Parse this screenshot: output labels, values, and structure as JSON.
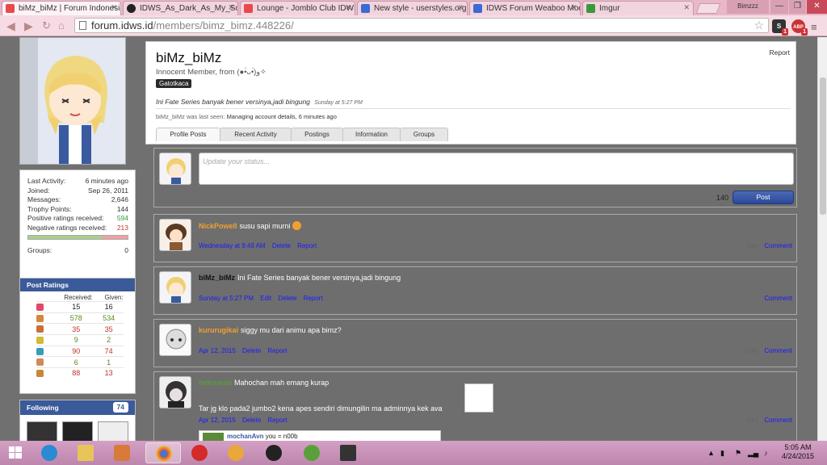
{
  "browser": {
    "tabs": [
      {
        "title": "biMz_biMz | Forum Indonesia",
        "icon": "idws-favicon-icon",
        "color": "#e84a4a",
        "active": false
      },
      {
        "title": "IDWS_As_Dark_As_My_Soul",
        "icon": "github-icon",
        "color": "#222222",
        "active": false
      },
      {
        "title": "Lounge - Jomblo Club IDWS",
        "icon": "idws-favicon-icon",
        "color": "#e84a4a",
        "active": false
      },
      {
        "title": "New style - userstyles.org",
        "icon": "userstyles-icon",
        "color": "#3a6ad4",
        "active": false
      },
      {
        "title": "IDWS Forum Weaboo Mode",
        "icon": "userstyles-icon",
        "color": "#3a6ad4",
        "active": false
      },
      {
        "title": "Imgur",
        "icon": "imgur-icon",
        "color": "#3a9a3a",
        "active": true
      }
    ],
    "user_label": "Bimzzz",
    "url_domain": "forum.idws.id",
    "url_path": "/members/bimz_bimz.448226/",
    "ext_badges": [
      "1",
      "1"
    ],
    "ext_abp": "ABP"
  },
  "sidebar": {
    "stats": [
      {
        "label": "Last Activity:",
        "value": "6 minutes ago",
        "tone": ""
      },
      {
        "label": "Joined:",
        "value": "Sep 26, 2011",
        "tone": ""
      },
      {
        "label": "Messages:",
        "value": "2,646",
        "tone": ""
      },
      {
        "label": "Trophy Points:",
        "value": "144",
        "tone": ""
      },
      {
        "label": "Positive ratings received:",
        "value": "594",
        "tone": "green"
      },
      {
        "label": "Negative ratings received:",
        "value": "213",
        "tone": "red"
      }
    ],
    "rating_positive_fraction": 0.74,
    "groups_label": "Groups:",
    "groups_value": "0",
    "post_ratings_title": "Post Ratings",
    "received_label": "Received:",
    "given_label": "Given:",
    "ratings": [
      {
        "icon": "heart-icon",
        "color": "#e04a6a",
        "received": "15",
        "given": "16",
        "tone": "#222222"
      },
      {
        "icon": "thumbs-up-icon",
        "color": "#d08a3a",
        "received": "578",
        "given": "534",
        "tone": "#5a8a1a"
      },
      {
        "icon": "thumbs-down-icon",
        "color": "#c8703a",
        "received": "35",
        "given": "35",
        "tone": "#c03030"
      },
      {
        "icon": "trophy-icon",
        "color": "#d4b83a",
        "received": "9",
        "given": "2",
        "tone": "#5a8a1a"
      },
      {
        "icon": "check-icon",
        "color": "#3a9ab8",
        "received": "90",
        "given": "74",
        "tone": "#c03030"
      },
      {
        "icon": "wrench-icon",
        "color": "#d08a5a",
        "received": "6",
        "given": "1",
        "tone": "#5a8a1a"
      },
      {
        "icon": "box-icon",
        "color": "#c8883a",
        "received": "88",
        "given": "13",
        "tone": "#c03030"
      }
    ],
    "following_title": "Following",
    "following_count": "74"
  },
  "profile": {
    "username": "biMz_biMz",
    "title": "Innocent Member, from (●•̀ᴗ•́)و✧",
    "badge": "Gatotkaca",
    "report": "Report",
    "status": "Ini Fate Series banyak bener versinya,jadi bingung",
    "status_time": "Sunday at 5:27 PM",
    "lastseen_user": "biMz_biMz",
    "lastseen_label": "was last seen:",
    "lastseen_text": "Managing account details, 6 minutes ago",
    "tabs": [
      "Profile Posts",
      "Recent Activity",
      "Postings",
      "Information",
      "Groups"
    ]
  },
  "statusbox": {
    "placeholder": "Update your status...",
    "char_count": "140",
    "post_label": "Post"
  },
  "feed": [
    {
      "user": "NickPowell",
      "user_color": "orange",
      "text": "susu sapi murni",
      "time": "Wednesday at 9:49 AM",
      "actions": [
        "Delete",
        "Report"
      ],
      "right": [
        "Like",
        "Comment"
      ]
    },
    {
      "user": "biMz_biMz",
      "user_color": "black",
      "text": "Ini Fate Series banyak bener versinya,jadi bingung",
      "time": "Sunday at 5:27 PM",
      "actions": [
        "Edit",
        "Delete",
        "Report"
      ],
      "right": [
        "Comment"
      ]
    },
    {
      "user": "kururugikai",
      "user_color": "orange",
      "text": "siggy mu dari animu apa bimz?",
      "time": "Apr 12, 2015",
      "actions": [
        "Delete",
        "Report"
      ],
      "right": [
        "Like",
        "Comment"
      ]
    },
    {
      "user": "hakisama",
      "user_color": "green",
      "text": "Mahochan mah emang kurap",
      "text2": "Tar jg klo pada2 jumbo2 kena apes sendiri dimungilin ma adminnya kek ava",
      "time": "Apr 12, 2015",
      "actions": [
        "Delete",
        "Report"
      ],
      "right": [
        "Like",
        "Comment"
      ],
      "reply_user": "mochanAvn",
      "reply_text": "you = n00b"
    }
  ],
  "taskbar": {
    "time": "5:05 AM",
    "date": "4/24/2015"
  }
}
